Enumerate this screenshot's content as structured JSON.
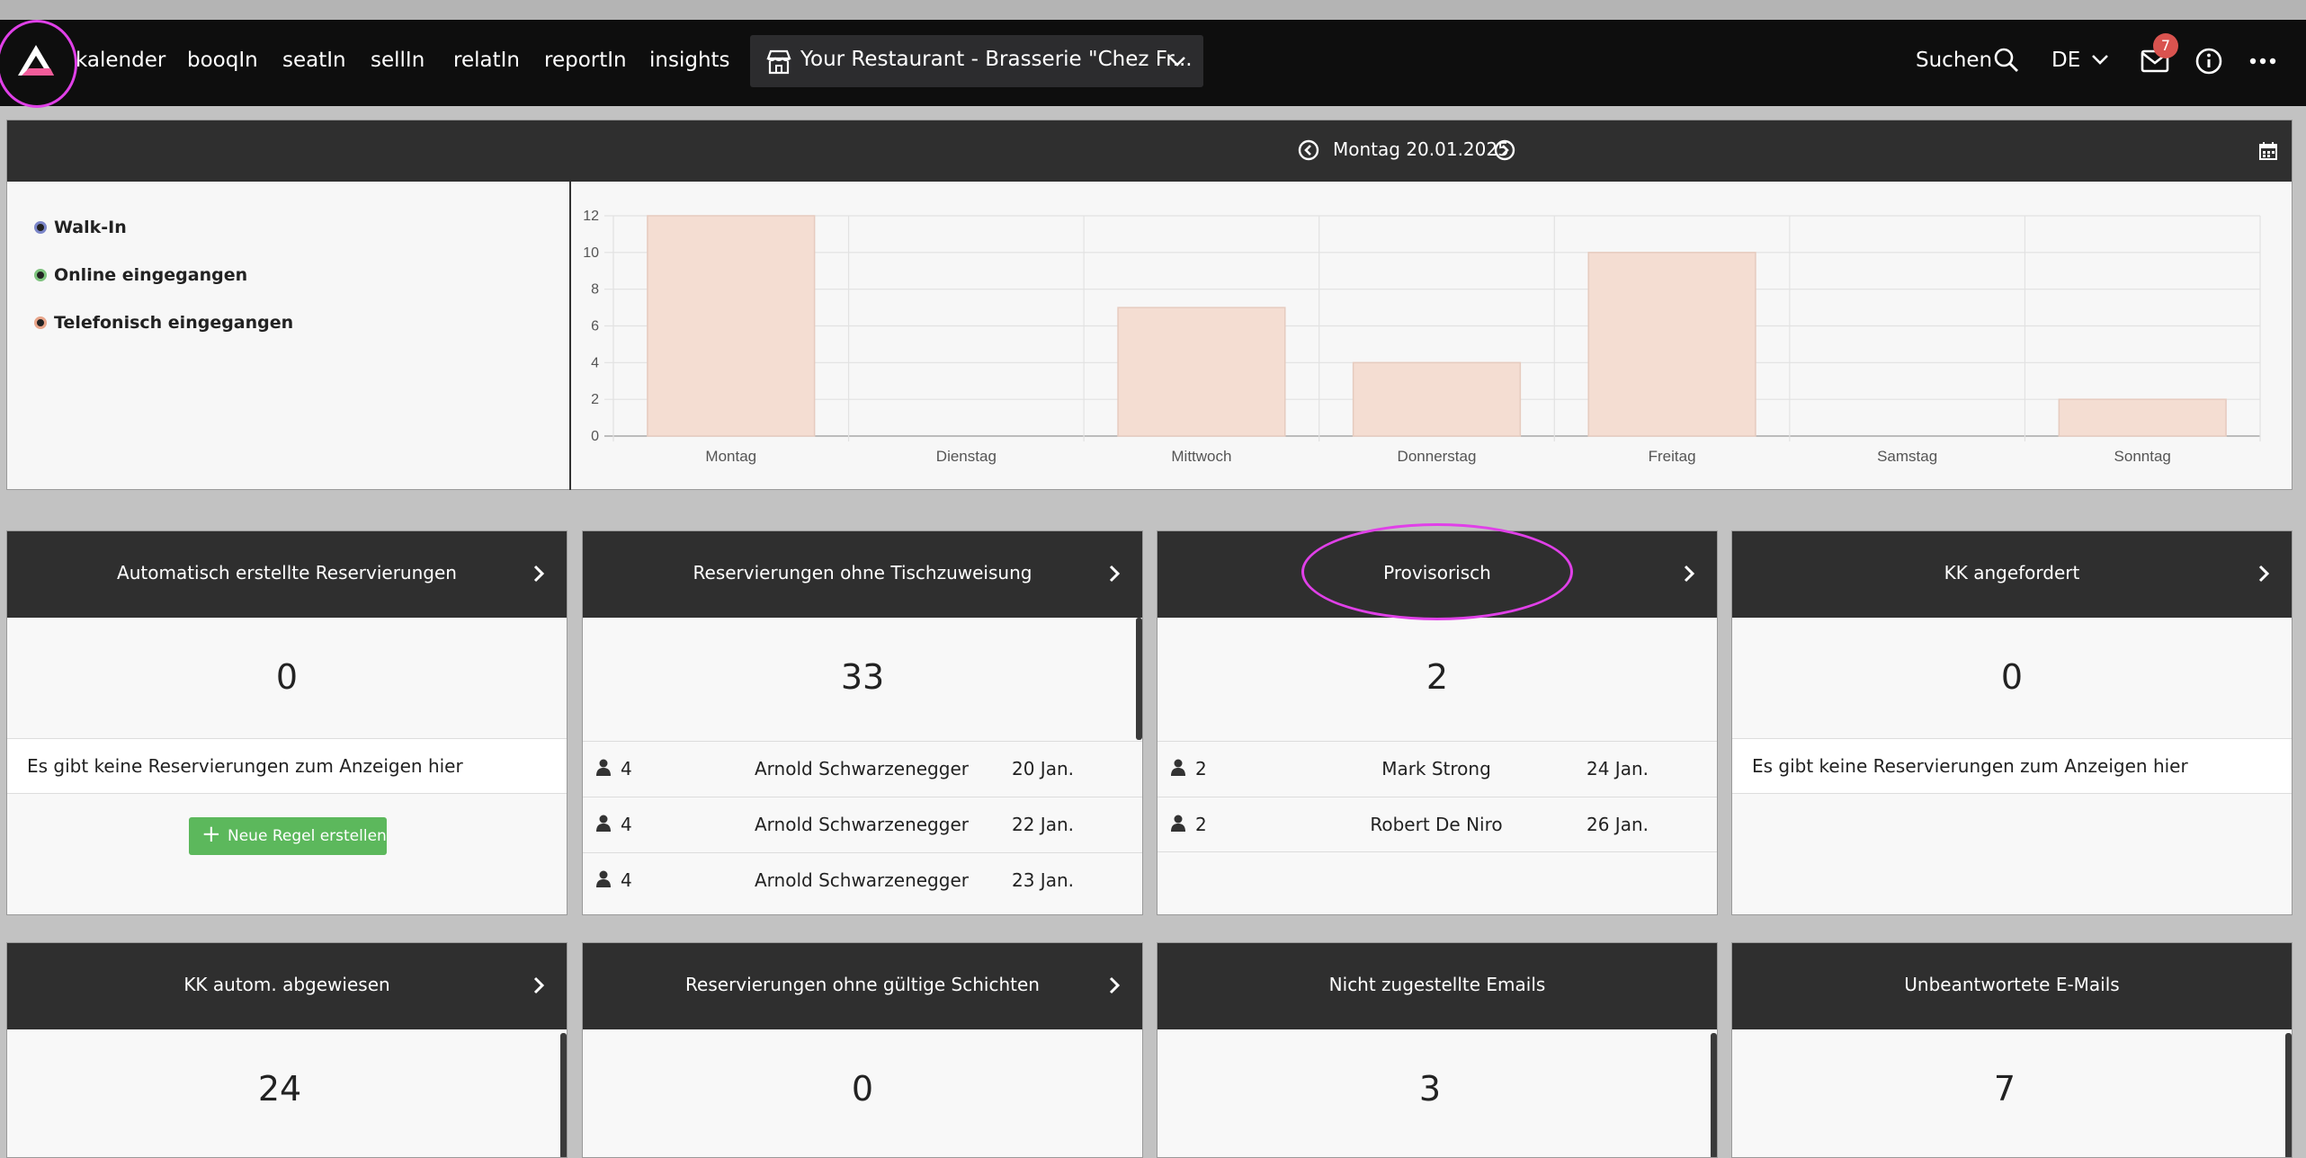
{
  "nav": {
    "items": [
      "kalender",
      "booqIn",
      "seatIn",
      "sellIn",
      "relatIn",
      "reportIn",
      "insights"
    ],
    "restaurant": "Your Restaurant - Brasserie \"Chez Fr...",
    "search_label": "Suchen",
    "language": "DE",
    "mail_badge": "7"
  },
  "chart_panel": {
    "date": "Montag 20.01.2025",
    "legend": [
      {
        "label": "Walk-In",
        "color": "#7b86c9"
      },
      {
        "label": "Online eingegangen",
        "color": "#7fc47f"
      },
      {
        "label": "Telefonisch eingegangen",
        "color": "#e8a58a"
      }
    ]
  },
  "chart_data": {
    "type": "bar",
    "categories": [
      "Montag",
      "Dienstag",
      "Mittwoch",
      "Donnerstag",
      "Freitag",
      "Samstag",
      "Sonntag"
    ],
    "series": [
      {
        "name": "Telefonisch eingegangen",
        "values": [
          12,
          0,
          7,
          4,
          10,
          0,
          2
        ],
        "color": "#f4ddd2"
      }
    ],
    "yticks": [
      0,
      2,
      4,
      6,
      8,
      10,
      12
    ],
    "ylim": [
      0,
      12
    ],
    "grid": true
  },
  "cards": [
    {
      "title": "Automatisch erstellte Reservierungen",
      "count": "0",
      "empty_text": "Es gibt keine Reservierungen zum Anzeigen hier",
      "button": "Neue Regel erstellen"
    },
    {
      "title": "Reservierungen ohne Tischzuweisung",
      "count": "33",
      "rows": [
        {
          "persons": "4",
          "name": "Arnold Schwarzenegger",
          "date": "20 Jan."
        },
        {
          "persons": "4",
          "name": "Arnold Schwarzenegger",
          "date": "22 Jan."
        },
        {
          "persons": "4",
          "name": "Arnold Schwarzenegger",
          "date": "23 Jan."
        }
      ]
    },
    {
      "title": "Provisorisch",
      "count": "2",
      "rows": [
        {
          "persons": "2",
          "name": "Mark Strong",
          "date": "24 Jan."
        },
        {
          "persons": "2",
          "name": "Robert De Niro",
          "date": "26 Jan."
        }
      ]
    },
    {
      "title": "KK angefordert",
      "count": "0",
      "empty_text": "Es gibt keine Reservierungen zum Anzeigen hier"
    },
    {
      "title": "KK autom. abgewiesen",
      "count": "24"
    },
    {
      "title": "Reservierungen ohne gültige Schichten",
      "count": "0"
    },
    {
      "title": "Nicht zugestellte Emails",
      "count": "3"
    },
    {
      "title": "Unbeantwortete E-Mails",
      "count": "7"
    }
  ]
}
